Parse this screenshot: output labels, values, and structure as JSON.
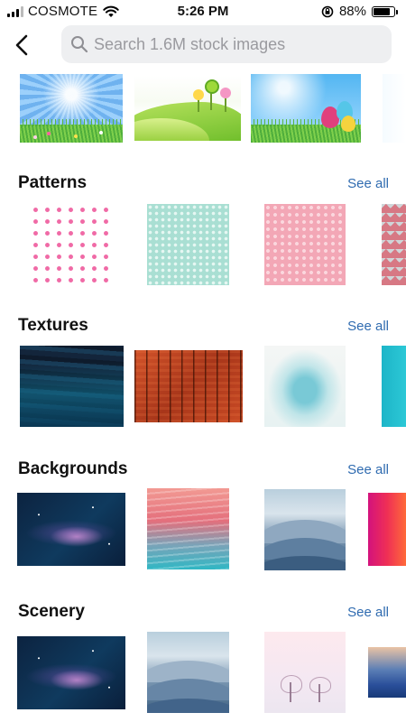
{
  "status_bar": {
    "carrier": "COSMOTE",
    "time": "5:26 PM",
    "battery_percent": "88%",
    "battery_level": 0.88,
    "icons": [
      "signal-icon",
      "wifi-icon",
      "orientation-lock-icon",
      "battery-icon"
    ]
  },
  "header": {
    "back_icon": "chevron-left-icon",
    "search_icon": "search-icon",
    "search_placeholder": "Search 1.6M stock images",
    "search_value": ""
  },
  "sections": [
    {
      "title": "Patterns",
      "see_all": "See all"
    },
    {
      "title": "Textures",
      "see_all": "See all"
    },
    {
      "title": "Backgrounds",
      "see_all": "See all"
    },
    {
      "title": "Scenery",
      "see_all": "See all"
    }
  ],
  "colors": {
    "accent_link": "#2f6bb0",
    "search_bg": "#eeeff1",
    "text_primary": "#111111",
    "placeholder": "#9a9a9f"
  }
}
